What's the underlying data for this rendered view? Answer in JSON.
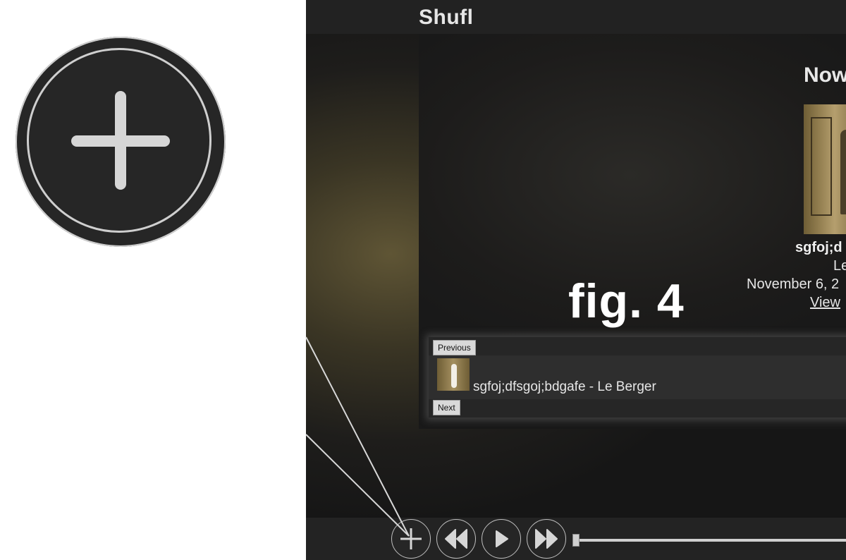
{
  "app": {
    "title": "Shufl"
  },
  "now_playing": {
    "heading": "Now",
    "title": "sgfoj;d",
    "artist": "Le",
    "date": "November 6, 2",
    "view_link": "View"
  },
  "figure_label": "fig. 4",
  "playlist": {
    "previous_label": "Previous",
    "next_label": "Next",
    "items": [
      {
        "label": "sgfoj;dfsgoj;bdgafe - Le Berger"
      }
    ]
  },
  "transport": {
    "buttons": [
      "add-icon",
      "rewind-icon",
      "play-icon",
      "fast-forward-icon"
    ],
    "seek_position": 0
  },
  "colors": {
    "accent": "#d6d6d6",
    "bar_bg": "#222222"
  }
}
